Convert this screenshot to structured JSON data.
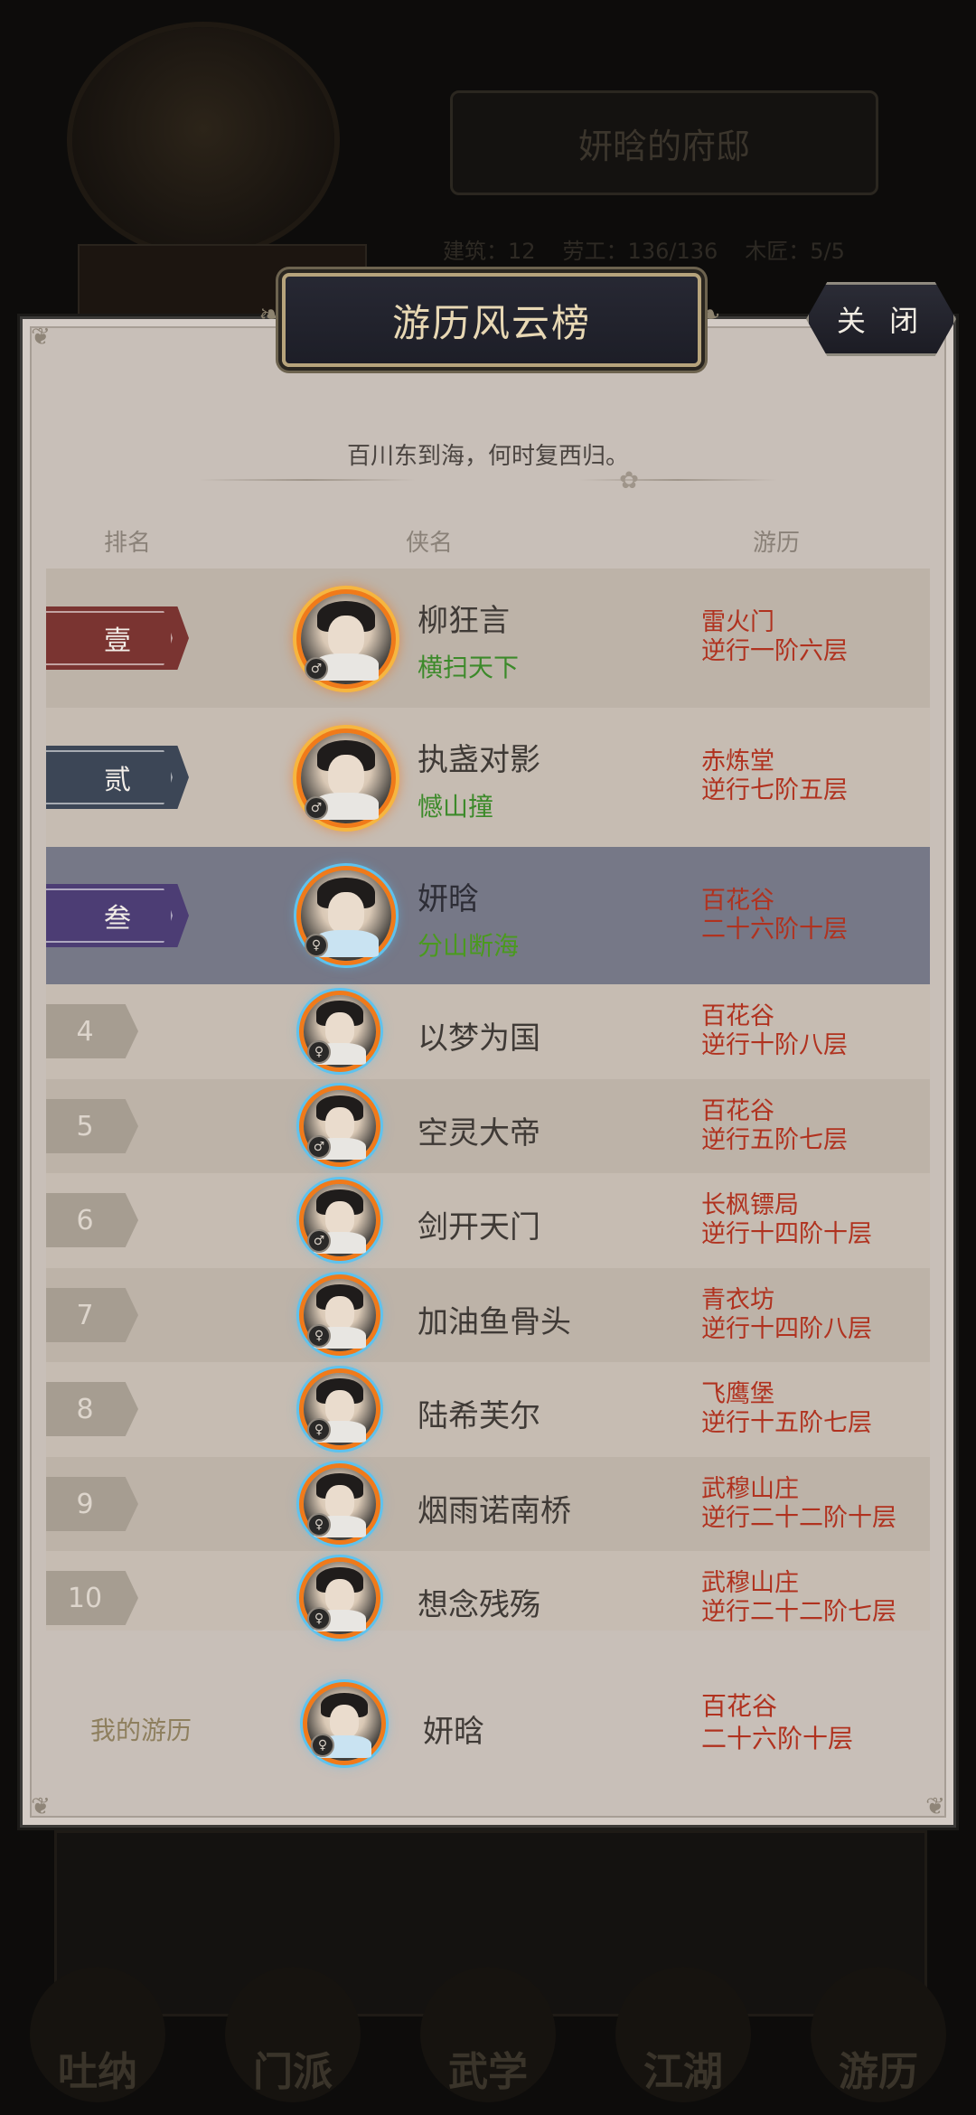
{
  "background": {
    "mansion_title": "妍晗的府邸",
    "stats": [
      "建筑：12",
      "劳工：136/136",
      "木匠：5/5"
    ],
    "nav": [
      "吐纳",
      "门派",
      "武学",
      "江湖",
      "游历"
    ]
  },
  "modal": {
    "title": "游历风云榜",
    "close_label": "关 闭",
    "subtitle": "百川东到海，何时复西归。",
    "headers": {
      "rank": "排名",
      "name": "侠名",
      "travel": "游历"
    }
  },
  "top3": [
    {
      "rank": "壹",
      "name": "柳狂言",
      "title": "横扫天下",
      "sect": "雷火门",
      "progress": "逆行一阶六层",
      "gender": "♂",
      "rank_color": "#7a3431",
      "avatar": "fire"
    },
    {
      "rank": "贰",
      "name": "执盏对影",
      "title": "憾山撞",
      "sect": "赤炼堂",
      "progress": "逆行七阶五层",
      "gender": "♂",
      "rank_color": "#3c4656",
      "avatar": "fire"
    },
    {
      "rank": "叁",
      "name": "妍晗",
      "title": "分山断海",
      "sect": "百花谷",
      "progress": "二十六阶十层",
      "gender": "♀",
      "rank_color": "#4c3d74",
      "avatar": "ice"
    }
  ],
  "others": [
    {
      "rank": "4",
      "name": "以梦为国",
      "sect": "百花谷",
      "progress": "逆行十阶八层",
      "gender": "♀"
    },
    {
      "rank": "5",
      "name": "空灵大帝",
      "sect": "百花谷",
      "progress": "逆行五阶七层",
      "gender": "♂"
    },
    {
      "rank": "6",
      "name": "剑开天门",
      "sect": "长枫镖局",
      "progress": "逆行十四阶十层",
      "gender": "♂"
    },
    {
      "rank": "7",
      "name": "加油鱼骨头",
      "sect": "青衣坊",
      "progress": "逆行十四阶八层",
      "gender": "♀"
    },
    {
      "rank": "8",
      "name": "陆希芙尔",
      "sect": "飞鹰堡",
      "progress": "逆行十五阶七层",
      "gender": "♀"
    },
    {
      "rank": "9",
      "name": "烟雨诺南桥",
      "sect": "武穆山庄",
      "progress": "逆行二十二阶十层",
      "gender": "♀"
    },
    {
      "rank": "10",
      "name": "想念残殇",
      "sect": "武穆山庄",
      "progress": "逆行二十二阶七层",
      "gender": "♀"
    }
  ],
  "mine": {
    "label": "我的游历",
    "name": "妍晗",
    "sect": "百花谷",
    "progress": "二十六阶十层",
    "gender": "♀"
  }
}
